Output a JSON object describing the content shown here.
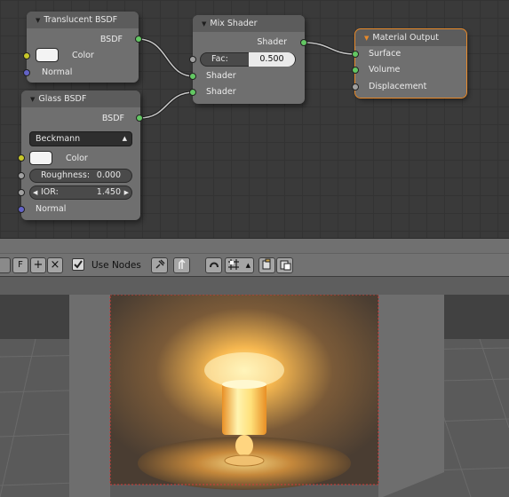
{
  "nodes": {
    "translucent": {
      "title": "Translucent BSDF",
      "output": "BSDF",
      "color_label": "Color",
      "normal_label": "Normal"
    },
    "glass": {
      "title": "Glass BSDF",
      "output": "BSDF",
      "distribution": "Beckmann",
      "color_label": "Color",
      "roughness_label": "Roughness:",
      "roughness_value": "0.000",
      "ior_label": "IOR:",
      "ior_value": "1.450",
      "normal_label": "Normal"
    },
    "mix": {
      "title": "Mix Shader",
      "output": "Shader",
      "fac_label": "Fac:",
      "fac_value": "0.500",
      "shader1": "Shader",
      "shader2": "Shader"
    },
    "output": {
      "title": "Material Output",
      "surface": "Surface",
      "volume": "Volume",
      "displacement": "Displacement"
    }
  },
  "header": {
    "f_button": "F",
    "plus": "+",
    "close": "×",
    "use_nodes_label": "Use Nodes",
    "use_nodes_checked": true
  },
  "icons": [
    "triangle-collapse-icon",
    "add-icon",
    "close-icon",
    "checkbox-icon",
    "pin-icon",
    "parent-icon",
    "snap-icon",
    "snap-element-icon",
    "copy-icon",
    "paste-icon"
  ],
  "colors": {
    "socket_shader": "#63c763",
    "socket_color": "#c7c729",
    "socket_vector": "#6363c7",
    "socket_value": "#a1a1a1",
    "selected_outline": "#e88a2a",
    "render_glow": "#ffb040"
  }
}
